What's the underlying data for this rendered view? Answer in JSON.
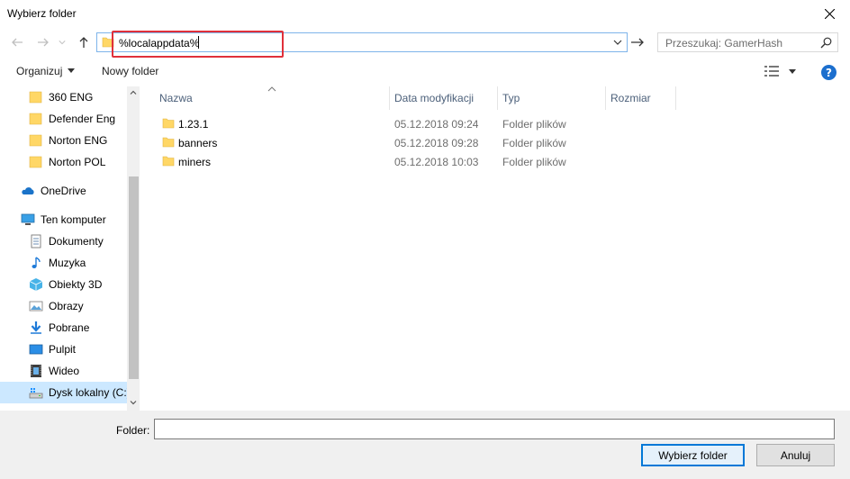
{
  "window": {
    "title": "Wybierz folder"
  },
  "address": {
    "value": "%localappdata%"
  },
  "search": {
    "placeholder": "Przeszukaj: GamerHash"
  },
  "toolbar": {
    "organize_label": "Organizuj",
    "new_folder_label": "Nowy folder"
  },
  "navigation": {
    "items": [
      {
        "label": "360 ENG",
        "icon": "folder-icon"
      },
      {
        "label": "Defender Eng",
        "icon": "folder-icon"
      },
      {
        "label": "Norton ENG",
        "icon": "folder-icon"
      },
      {
        "label": "Norton POL",
        "icon": "folder-icon"
      },
      {
        "label": "OneDrive",
        "icon": "onedrive-icon"
      },
      {
        "label": "Ten komputer",
        "icon": "computer-icon"
      },
      {
        "label": "Dokumenty",
        "icon": "documents-icon"
      },
      {
        "label": "Muzyka",
        "icon": "music-icon"
      },
      {
        "label": "Obiekty 3D",
        "icon": "objects-3d-icon"
      },
      {
        "label": "Obrazy",
        "icon": "pictures-icon"
      },
      {
        "label": "Pobrane",
        "icon": "downloads-icon"
      },
      {
        "label": "Pulpit",
        "icon": "desktop-icon"
      },
      {
        "label": "Wideo",
        "icon": "video-icon"
      },
      {
        "label": "Dysk lokalny (C:)",
        "icon": "local-disk-icon",
        "selected": true
      }
    ]
  },
  "files": {
    "columns": [
      "Nazwa",
      "Data modyfikacji",
      "Typ",
      "Rozmiar"
    ],
    "rows": [
      {
        "name": "1.23.1",
        "date": "05.12.2018 09:24",
        "type": "Folder plików"
      },
      {
        "name": "banners",
        "date": "05.12.2018 09:28",
        "type": "Folder plików"
      },
      {
        "name": "miners",
        "date": "05.12.2018 10:03",
        "type": "Folder plików"
      }
    ]
  },
  "footer": {
    "folder_label": "Folder:",
    "select_button": "Wybierz folder",
    "cancel_button": "Anuluj"
  },
  "colors": {
    "highlight": "#e0303a",
    "accent": "#0078d7",
    "selection": "#cce8ff",
    "folder": "#ffd766"
  }
}
